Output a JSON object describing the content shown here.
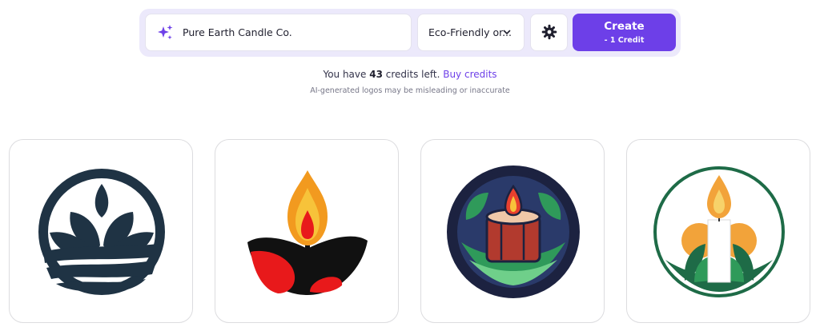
{
  "prompt_bar": {
    "name_value": "Pure Earth Candle Co.",
    "style_label": "Eco-Friendly or...",
    "create_label": "Create",
    "create_cost": "- 1 Credit"
  },
  "credits": {
    "prefix": "You have",
    "count": "43",
    "suffix": "credits left.",
    "buy_label": "Buy credits"
  },
  "disclaimer": "AI-generated logos may be misleading or inaccurate",
  "colors": {
    "accent": "#6d3fe8",
    "bar_bg": "#ece9fb"
  },
  "icons": [
    "sparkle-icon",
    "chevron-down-icon",
    "gear-icon"
  ]
}
